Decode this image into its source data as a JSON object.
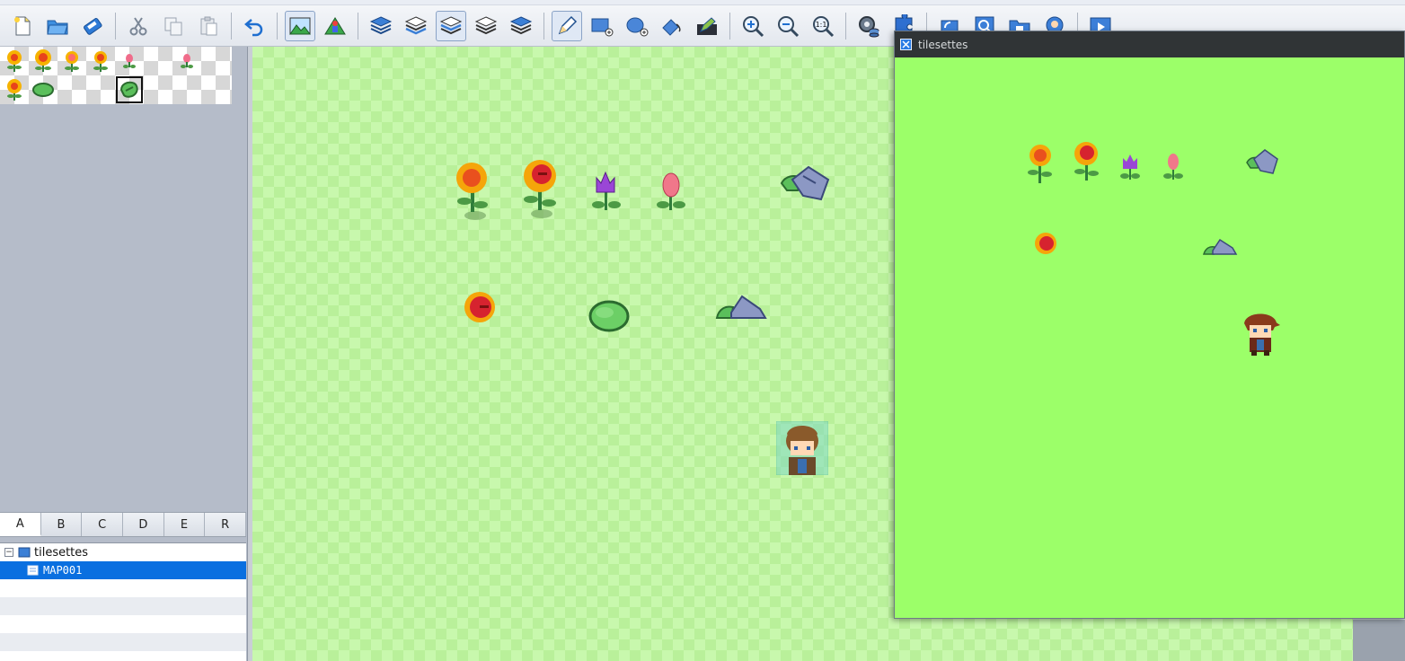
{
  "toolbar": {
    "buttons": [
      {
        "name": "new-project-icon"
      },
      {
        "name": "open-project-icon"
      },
      {
        "name": "save-project-icon"
      },
      {
        "name": "cut-icon"
      },
      {
        "name": "copy-icon"
      },
      {
        "name": "paste-icon"
      },
      {
        "name": "undo-icon"
      },
      {
        "name": "map-mode-icon",
        "pressed": true
      },
      {
        "name": "event-mode-icon"
      },
      {
        "name": "layer-auto-icon"
      },
      {
        "name": "layer-1-icon"
      },
      {
        "name": "layer-2-icon",
        "pressed": true
      },
      {
        "name": "layer-3-icon"
      },
      {
        "name": "layer-4-icon"
      },
      {
        "name": "pencil-tool-icon",
        "pressed": true
      },
      {
        "name": "rectangle-tool-icon"
      },
      {
        "name": "ellipse-tool-icon"
      },
      {
        "name": "fill-tool-icon"
      },
      {
        "name": "shadow-pen-icon"
      },
      {
        "name": "zoom-in-icon"
      },
      {
        "name": "zoom-out-icon"
      },
      {
        "name": "zoom-actual-icon"
      },
      {
        "name": "database-icon"
      },
      {
        "name": "plugin-manager-icon"
      },
      {
        "name": "sound-test-icon"
      },
      {
        "name": "event-searcher-icon"
      },
      {
        "name": "resource-manager-icon"
      },
      {
        "name": "character-generator-icon"
      },
      {
        "name": "playtest-icon"
      }
    ],
    "zoom_actual_label": "1:1"
  },
  "tileset_tabs": {
    "labels": [
      "A",
      "B",
      "C",
      "D",
      "E",
      "R"
    ],
    "active": "A"
  },
  "project_tree": {
    "project_label": "tilesettes",
    "toggle_symbol": "−",
    "map_label": "MAP001"
  },
  "preview_window": {
    "title": "tilesettes"
  },
  "colors": {
    "selection_blue": "#0a6fe0",
    "preview_bg": "#9cff69",
    "map_check_light": "#c8f8ad",
    "map_check_dark": "#b9f09a",
    "titlebar_dark": "#303436"
  }
}
